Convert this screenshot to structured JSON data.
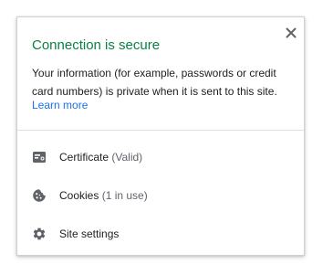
{
  "popup": {
    "title": "Connection is secure",
    "description": "Your information (for example, passwords or credit card numbers) is private when it is sent to this site.",
    "learn_more": "Learn more",
    "close_icon": "close-icon"
  },
  "items": [
    {
      "label": "Certificate",
      "detail": "(Valid)",
      "icon": "certificate-icon"
    },
    {
      "label": "Cookies",
      "detail": "(1 in use)",
      "icon": "cookie-icon"
    },
    {
      "label": "Site settings",
      "detail": "",
      "icon": "gear-icon"
    }
  ],
  "colors": {
    "secure_green": "#0b8043",
    "link_blue": "#1a73e8",
    "text": "#202124",
    "secondary_text": "#5f6368"
  }
}
